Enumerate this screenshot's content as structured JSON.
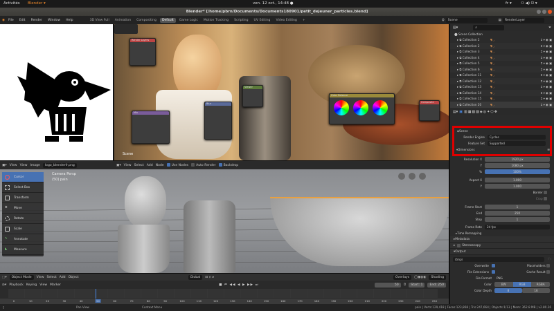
{
  "gnome": {
    "activities": "Activités",
    "app": "Blender ▾",
    "clock": "ven. 12 oct., 14:48 ●",
    "lang": "fr ▾"
  },
  "window": {
    "title": "Blender* [/home/pbrn/Documents/Documents180901/petit_dejeuner_particles.blend]"
  },
  "menu": [
    "File",
    "Edit",
    "Render",
    "Window",
    "Help"
  ],
  "workspaces": [
    "3D View Full",
    "Animation",
    "Compositing",
    "Default",
    "Game Logic",
    "Motion Tracking",
    "Scripting",
    "UV Editing",
    "Video Editing",
    "+"
  ],
  "active_workspace": "Default",
  "scene": "Scene",
  "view_layer": "RenderLayer",
  "image_editor": {
    "view": "View",
    "view2": "View",
    "image": "Image",
    "image_name": "logo_blenderfr.png"
  },
  "node_editor": {
    "menus": [
      "View",
      "Select",
      "Add",
      "Node"
    ],
    "use_nodes": "Use Nodes",
    "auto_render": "Auto Render",
    "backdrop": "Backdrop",
    "scene_label": "Scene"
  },
  "nodes": {
    "render_layers": "Render Layers",
    "mix": "Mix",
    "color_balance": "Color Balance",
    "viewer": "Viewer",
    "blur": "Blur",
    "composite": "Composite"
  },
  "viewport": {
    "camera": "Camera Persp",
    "collection": "(50) pain",
    "mode": "Object Mode",
    "menus": [
      "View",
      "Select",
      "Add",
      "Object"
    ],
    "orientation": "Global",
    "overlays": "Overlays",
    "shading": "Shading"
  },
  "tools": [
    "Cursor",
    "Select Box",
    "Transform",
    "Move",
    "Rotate",
    "Scale",
    "Annotate",
    "Measure"
  ],
  "outliner": {
    "root": "Scene Collection",
    "items": [
      "Collection 2",
      "Collection 2",
      "Collection 3",
      "Collection 4",
      "Collection 5",
      "Collection 6",
      "Collection 11",
      "Collection 12",
      "Collection 13",
      "Collection 14",
      "Collection 15",
      "Collection 20"
    ]
  },
  "properties": {
    "scene": "Scene",
    "render_engine_label": "Render Engine",
    "render_engine": "Cycles",
    "feature_set_label": "Feature Set",
    "feature_set": "Supported",
    "dimensions": "Dimensions",
    "res_x_label": "Resolution X",
    "res_x": "1920 px",
    "res_y_label": "Y",
    "res_y": "1080 px",
    "pct_label": "%",
    "pct": "100%",
    "aspect_x_label": "Aspect X",
    "aspect_x": "1.000",
    "aspect_y_label": "Y",
    "aspect_y": "1.000",
    "border": "Border",
    "crop": "Crop",
    "frame_start_label": "Frame Start",
    "frame_start": "1",
    "end_label": "End",
    "end": "250",
    "step_label": "Step",
    "step": "1",
    "frame_rate_label": "Frame Rate",
    "frame_rate": "24 fps",
    "time_remapping": "Time Remapping",
    "metadata": "Metadata",
    "stereoscopy": "Stereoscopy",
    "output": "Output",
    "output_path": "/tmp\\",
    "overwrite": "Overwrite",
    "placeholders": "Placeholders",
    "file_extensions": "File Extensions",
    "cache_result": "Cache Result",
    "file_format_label": "File Format",
    "file_format": "PNG",
    "color_label": "Color",
    "color_opts": [
      "BW",
      "RGB",
      "RGBA"
    ],
    "depth_label": "Color Depth",
    "depth_opts": [
      "8",
      "16"
    ]
  },
  "timeline": {
    "menus": [
      "Playback",
      "Keying",
      "View",
      "Marker"
    ],
    "current": "50",
    "start_label": "Start:",
    "start": "1",
    "end_label": "End:",
    "end": "250",
    "ticks": [
      "0",
      "10",
      "20",
      "30",
      "40",
      "50",
      "60",
      "70",
      "80",
      "90",
      "100",
      "110",
      "120",
      "130",
      "140",
      "150",
      "160",
      "170",
      "180",
      "190",
      "200",
      "210",
      "220",
      "230",
      "240",
      "250"
    ]
  },
  "status": {
    "pan": "Pan View",
    "context": "Context Menu",
    "stats": "pain | Verts:129,418 | Faces:123,868 | Tris:247,664 | Objects:1/13 | Mem: 362.8 MB | v2.80.26"
  },
  "colors": {
    "accent": "#4772b3",
    "highlight_box": "#e00000"
  }
}
